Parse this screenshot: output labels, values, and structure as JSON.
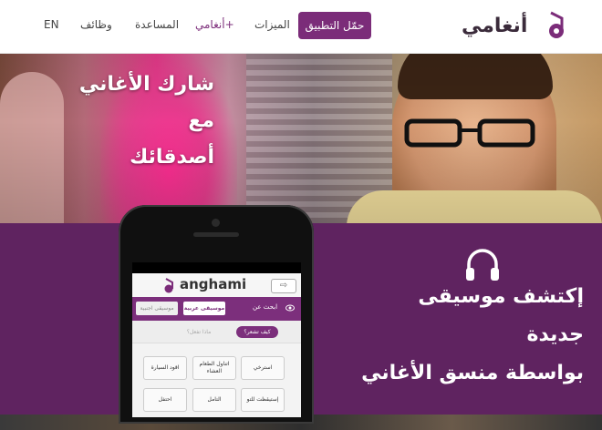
{
  "nav": {
    "lang": "EN",
    "jobs": "وظائف",
    "help": "المساعدة",
    "plus": "أنغامي+",
    "features": "الميزات",
    "download": "حمّل التطبيق",
    "brand": "أنغامي"
  },
  "hero": {
    "title_line1": "شارك الأغاني مع",
    "title_line2": "أصدقائك"
  },
  "band": {
    "title_line1": "إكتشف موسيقى جديدة",
    "title_line2": "بواسطة منسق الأغاني"
  },
  "phone": {
    "app_name": "anghami",
    "back": "⇨",
    "search_about": "ابحث عن",
    "chip_arabic": "موسيقى عربية",
    "chip_foreign": "موسيقى اجنبية",
    "how_feel": "كيف تشعر؟",
    "what_doing": "ماذا تفعل؟",
    "moods": [
      "استرخي",
      "اتناول الطعام العشاء",
      "اقود السيارة",
      "إستيقظت للتو",
      "التامل",
      "احتفل"
    ]
  },
  "colors": {
    "brand_purple": "#7b2c79",
    "band_purple": "#5f2360"
  },
  "icons": {
    "headphones": "headphones-icon",
    "logo": "anghami-logo-icon",
    "eye": "eye-icon"
  }
}
